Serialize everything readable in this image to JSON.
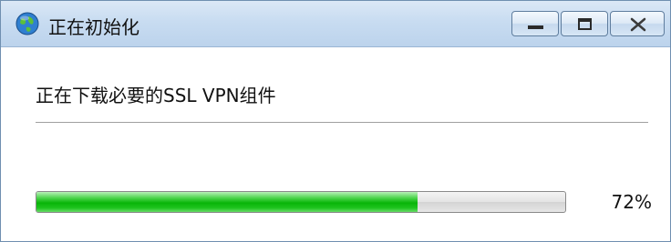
{
  "window": {
    "title": "正在初始化",
    "controls": {
      "minimize": "minimize-icon",
      "maximize": "maximize-icon",
      "close": "close-icon"
    }
  },
  "main": {
    "status_text": "正在下载必要的SSL VPN组件",
    "progress": {
      "value_percent": 72,
      "label": "72%"
    }
  },
  "colors": {
    "progress_fill": "#09b509",
    "titlebar": "#c8dcf1"
  }
}
